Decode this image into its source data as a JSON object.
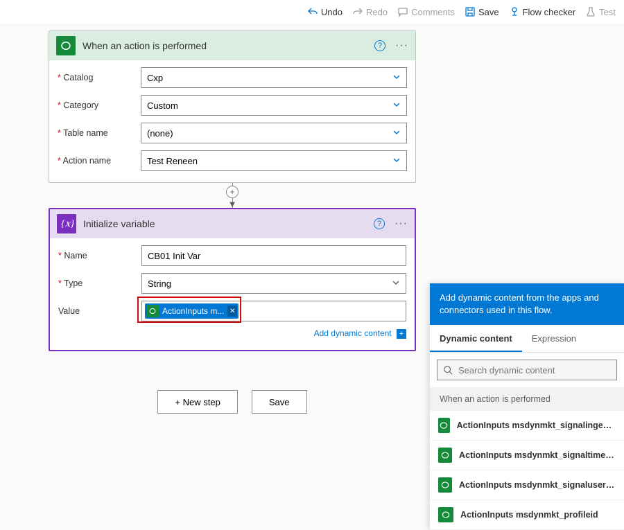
{
  "toolbar": {
    "undo": "Undo",
    "redo": "Redo",
    "comments": "Comments",
    "save": "Save",
    "flow_checker": "Flow checker",
    "test": "Test"
  },
  "trigger": {
    "title": "When an action is performed",
    "fields": {
      "catalog_label": "Catalog",
      "catalog_value": "Cxp",
      "category_label": "Category",
      "category_value": "Custom",
      "table_label": "Table name",
      "table_value": "(none)",
      "action_label": "Action name",
      "action_value": "Test Reneen"
    }
  },
  "action": {
    "title": "Initialize variable",
    "fields": {
      "name_label": "Name",
      "name_value": "CB01 Init Var",
      "type_label": "Type",
      "type_value": "String",
      "value_label": "Value",
      "token_label": "ActionInputs m..."
    },
    "add_dynamic": "Add dynamic content"
  },
  "buttons": {
    "new_step": "+ New step",
    "save": "Save"
  },
  "dyn_panel": {
    "header": "Add dynamic content from the apps and connectors used in this flow.",
    "tab_dynamic": "Dynamic content",
    "tab_expression": "Expression",
    "search_placeholder": "Search dynamic content",
    "group": "When an action is performed",
    "items": [
      "ActionInputs msdynmkt_signalingestiontimestamp",
      "ActionInputs msdynmkt_signaltimestamp",
      "ActionInputs msdynmkt_signaluserauthid",
      "ActionInputs msdynmkt_profileid"
    ]
  }
}
